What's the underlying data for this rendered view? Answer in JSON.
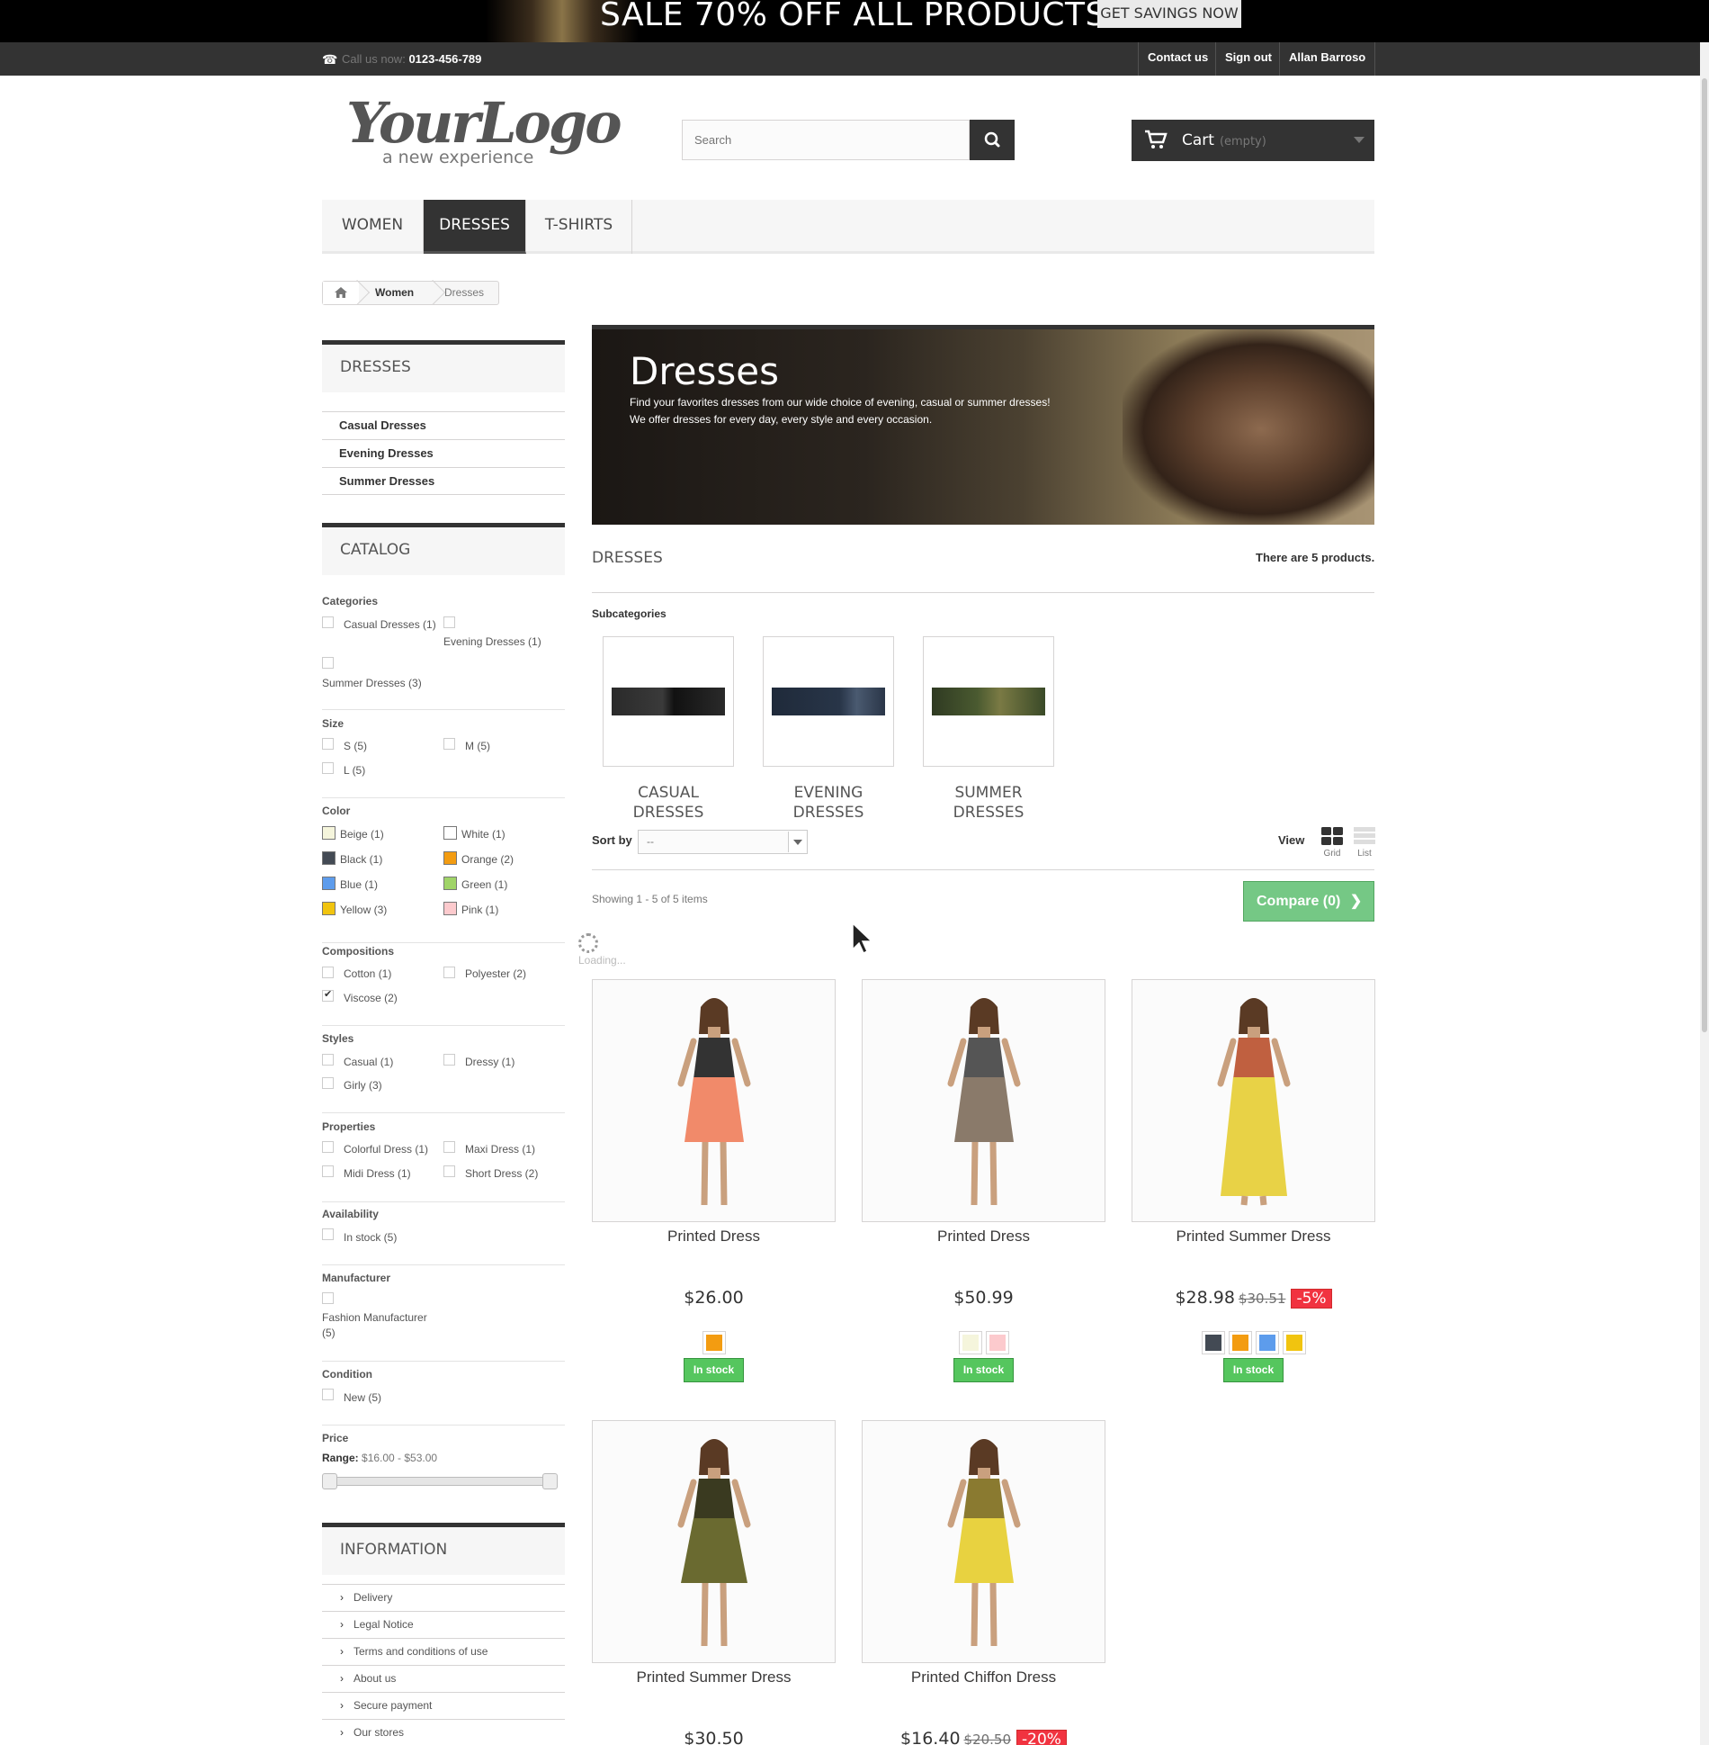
{
  "promo": {
    "text": "SALE 70% OFF ALL PRODUCTS",
    "button": "GET SAVINGS NOW"
  },
  "topnav": {
    "call_label": "Call us now:",
    "phone": "0123-456-789",
    "links": [
      "Contact us",
      "Sign out",
      "Allan Barroso"
    ]
  },
  "header": {
    "logo_main": "YourLogo",
    "logo_sub": "a new experience",
    "search_placeholder": "Search",
    "cart_label": "Cart",
    "cart_status": "(empty)"
  },
  "menu": [
    "WOMEN",
    "DRESSES",
    "T-SHIRTS"
  ],
  "breadcrumb": [
    "Women",
    "Dresses"
  ],
  "sidebar": {
    "category_title": "DRESSES",
    "category_links": [
      "Casual Dresses",
      "Evening Dresses",
      "Summer Dresses"
    ],
    "catalog_title": "CATALOG",
    "filters": {
      "categories_head": "Categories",
      "categories": [
        "Casual Dresses (1)",
        "Evening Dresses (1)",
        "Summer Dresses (3)"
      ],
      "size_head": "Size",
      "sizes": [
        "S (5)",
        "M (5)",
        "L (5)"
      ],
      "color_head": "Color",
      "colors": [
        {
          "label": "Beige (1)",
          "hex": "#f5f5dc"
        },
        {
          "label": "White (1)",
          "hex": "#ffffff"
        },
        {
          "label": "Black (1)",
          "hex": "#434a54"
        },
        {
          "label": "Orange (2)",
          "hex": "#f39c11"
        },
        {
          "label": "Blue (1)",
          "hex": "#5d9cec"
        },
        {
          "label": "Green (1)",
          "hex": "#a0d468"
        },
        {
          "label": "Yellow (3)",
          "hex": "#f1c40f"
        },
        {
          "label": "Pink (1)",
          "hex": "#fccacd"
        }
      ],
      "compositions_head": "Compositions",
      "compositions": [
        "Cotton (1)",
        "Polyester (2)",
        "Viscose (2)"
      ],
      "styles_head": "Styles",
      "styles": [
        "Casual (1)",
        "Dressy (1)",
        "Girly (3)"
      ],
      "properties_head": "Properties",
      "properties": [
        "Colorful Dress (1)",
        "Maxi Dress (1)",
        "Midi Dress (1)",
        "Short Dress (2)"
      ],
      "availability_head": "Availability",
      "availability": [
        "In stock (5)"
      ],
      "manufacturer_head": "Manufacturer",
      "manufacturer_line1": "Fashion Manufacturer",
      "manufacturer_line2": "(5)",
      "condition_head": "Condition",
      "condition": [
        "New (5)"
      ],
      "price_head": "Price",
      "range_label": "Range:",
      "range_value": "$16.00 - $53.00"
    },
    "information_title": "INFORMATION",
    "information_links": [
      "Delivery",
      "Legal Notice",
      "Terms and conditions of use",
      "About us",
      "Secure payment",
      "Our stores"
    ]
  },
  "hero": {
    "title": "Dresses",
    "line1": "Find your favorites dresses from our wide choice of evening, casual or summer dresses!",
    "line2": "We offer dresses for every day, every style and every occasion."
  },
  "listing": {
    "heading": "DRESSES",
    "count": "There are 5 products.",
    "subcategories_head": "Subcategories",
    "subcategories": [
      {
        "line1": "CASUAL",
        "line2": "DRESSES"
      },
      {
        "line1": "EVENING",
        "line2": "DRESSES"
      },
      {
        "line1": "SUMMER",
        "line2": "DRESSES"
      }
    ],
    "sort_label": "Sort by",
    "sort_value": "--",
    "view_label": "View",
    "view_grid": "Grid",
    "view_list": "List",
    "showing": "Showing 1 - 5 of 5 items",
    "compare": "Compare (0)",
    "loading": "Loading..."
  },
  "products": [
    {
      "name": "Printed Dress",
      "price": "$26.00",
      "old_price": "",
      "discount": "",
      "colors": [
        "#f39c11"
      ],
      "stock": "In stock"
    },
    {
      "name": "Printed Dress",
      "price": "$50.99",
      "old_price": "",
      "discount": "",
      "colors": [
        "#f5f5dc",
        "#fccacd"
      ],
      "stock": "In stock"
    },
    {
      "name": "Printed Summer Dress",
      "price": "$28.98",
      "old_price": "$30.51",
      "discount": "-5%",
      "colors": [
        "#434a54",
        "#f39c11",
        "#5d9cec",
        "#f1c40f"
      ],
      "stock": "In stock"
    },
    {
      "name": "Printed Summer Dress",
      "price": "$30.50",
      "old_price": "",
      "discount": "",
      "colors": [],
      "stock": ""
    },
    {
      "name": "Printed Chiffon Dress",
      "price": "$16.40",
      "old_price": "$20.50",
      "discount": "-20%",
      "colors": [],
      "stock": ""
    }
  ]
}
